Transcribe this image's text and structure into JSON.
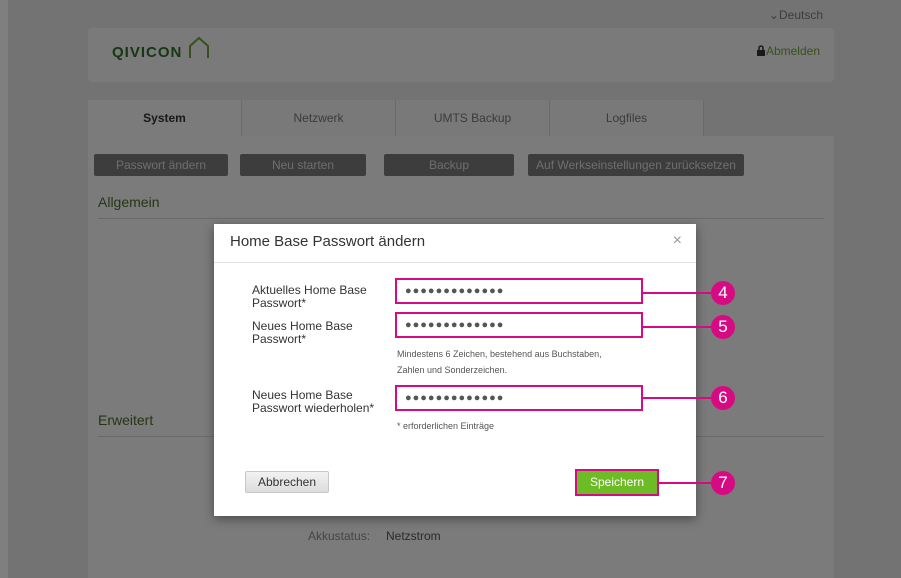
{
  "header": {
    "language": "⌄Deutsch",
    "logo": "QIVICON",
    "logout": "Abmelden",
    "lock_icon": "lock-icon",
    "house_icon": "house-icon"
  },
  "tabs": [
    {
      "label": "System",
      "active": true
    },
    {
      "label": "Netzwerk",
      "active": false
    },
    {
      "label": "UMTS Backup",
      "active": false
    },
    {
      "label": "Logfiles",
      "active": false
    }
  ],
  "actions": {
    "change_password": "Passwort ändern",
    "restart": "Neu starten",
    "backup": "Backup",
    "factory_reset": "Auf Werkseinstellungen zurücksetzen"
  },
  "sections": {
    "general": "Allgemein",
    "advanced": "Erweitert"
  },
  "status": {
    "battery_label": "Akkustatus:",
    "battery_value": "Netzstrom"
  },
  "modal": {
    "title": "Home Base Passwort ändern",
    "close": "×",
    "current_label_1": "Aktuelles Home Base",
    "current_label_2": "Passwort*",
    "current_value": "●●●●●●●●●●●●●",
    "new_label_1": "Neues Home Base",
    "new_label_2": "Passwort*",
    "new_value": "●●●●●●●●●●●●●",
    "hint_1": "Mindestens 6 Zeichen, bestehend aus Buchstaben,",
    "hint_2": "Zahlen und Sonderzeichen.",
    "repeat_label_1": "Neues Home Base",
    "repeat_label_2": "Passwort wiederholen*",
    "repeat_value": "●●●●●●●●●●●●●",
    "required_note": "* erforderlichen Einträge",
    "cancel": "Abbrechen",
    "save": "Speichern"
  },
  "callouts": [
    "4",
    "5",
    "6",
    "7"
  ],
  "colors": {
    "highlight": "#d60b84",
    "accent_green": "#6dbb25",
    "overlay": "rgba(0,0,0,0.5)"
  }
}
